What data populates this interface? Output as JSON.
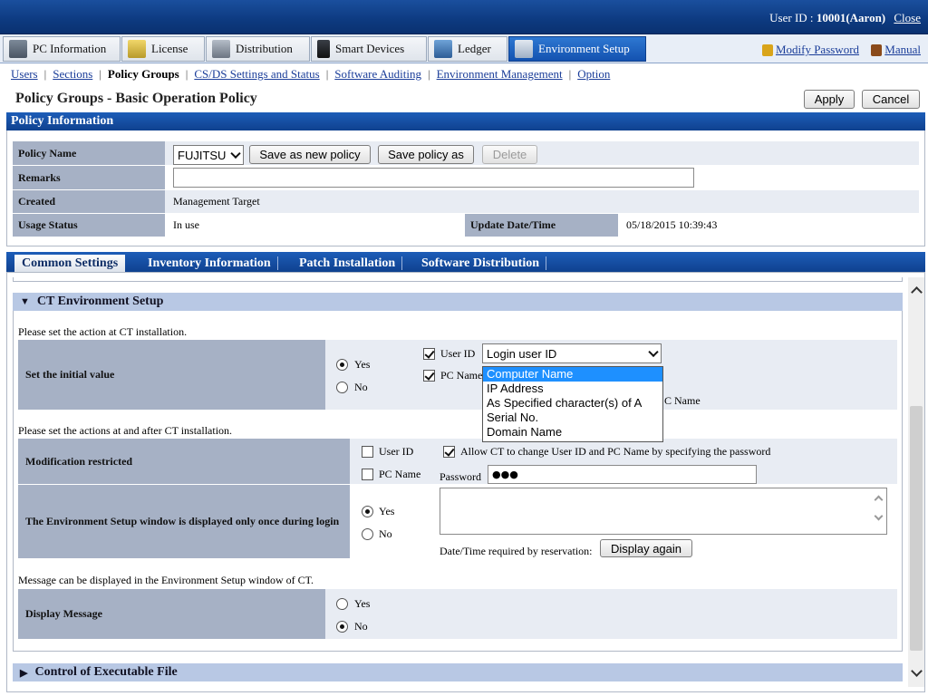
{
  "header": {
    "user_id_label": "User ID : ",
    "user_id_value": "10001(Aaron)",
    "close_label": "Close"
  },
  "main_tabs": [
    {
      "label": "PC Information",
      "icon": "pc-icon"
    },
    {
      "label": "License",
      "icon": "license-icon"
    },
    {
      "label": "Distribution",
      "icon": "distribution-icon"
    },
    {
      "label": "Smart Devices",
      "icon": "smart-device-icon"
    },
    {
      "label": "Ledger",
      "icon": "ledger-icon"
    },
    {
      "label": "Environment Setup",
      "icon": "tools-icon",
      "active": true
    }
  ],
  "top_links": {
    "modify_password": "Modify Password",
    "manual": "Manual"
  },
  "subnav": [
    "Users",
    "Sections",
    "Policy Groups",
    "CS/DS Settings and Status",
    "Software Auditing",
    "Environment Management",
    "Option"
  ],
  "page": {
    "title": "Policy Groups - Basic Operation Policy",
    "apply": "Apply",
    "cancel": "Cancel"
  },
  "policy_info": {
    "header": "Policy Information",
    "policy_name_label": "Policy Name",
    "policy_name_value": "FUJITSU",
    "save_new": "Save as new policy",
    "save_as": "Save policy as",
    "delete": "Delete",
    "remarks_label": "Remarks",
    "remarks_value": "",
    "created_label": "Created",
    "created_value": "Management Target",
    "usage_label": "Usage Status",
    "usage_value": "In use",
    "update_label": "Update Date/Time",
    "update_value": "05/18/2015 10:39:43"
  },
  "section_tabs": [
    "Common Settings",
    "Inventory Information",
    "Patch Installation",
    "Software Distribution"
  ],
  "ct_env": {
    "header": "CT Environment Setup",
    "note1": "Please set the action at CT installation.",
    "initial_label": "Set the initial value",
    "yes": "Yes",
    "no": "No",
    "user_id": "User ID",
    "pc_name": "PC Name",
    "user_id_select": "Login user ID",
    "pc_name_tail": "C Name",
    "dropdown_options": [
      "Computer Name",
      "IP Address",
      "As Specified character(s) of A",
      "Serial No.",
      "Domain Name"
    ],
    "note2": "Please set the actions at and after CT installation.",
    "mod_label": "Modification restricted",
    "allow_ct": "Allow CT to change User ID and PC Name by specifying the password",
    "password_label": "Password",
    "password_value": "●●●",
    "env_window_label": "The Environment Setup window is displayed only once during login",
    "datetime_label": "Date/Time required by reservation:",
    "display_again": "Display again",
    "note3": "Message can be displayed in the Environment Setup window of CT.",
    "display_msg_label": "Display Message"
  },
  "exec_section": {
    "header": "Control of Executable File"
  },
  "colors": {
    "header_blue": "#0d3a80",
    "active_tab": "#1452b0",
    "label_bg": "#a6b1c5",
    "row_bg": "#e8ecf3",
    "section_bg": "#b8c8e4",
    "highlight": "#1e90ff"
  }
}
